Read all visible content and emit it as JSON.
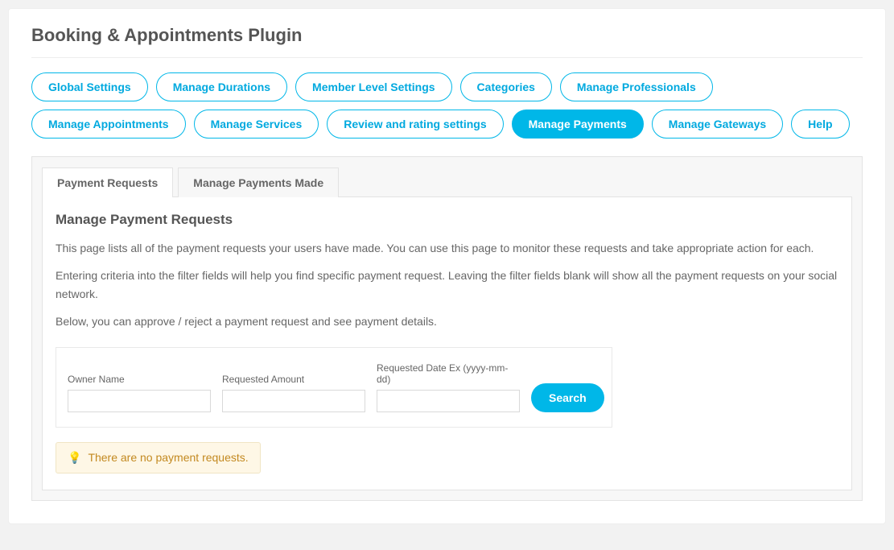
{
  "header": {
    "title": "Booking & Appointments Plugin"
  },
  "nav_pills": {
    "global_settings": "Global Settings",
    "manage_durations": "Manage Durations",
    "member_level_settings": "Member Level Settings",
    "categories": "Categories",
    "manage_professionals": "Manage Professionals",
    "manage_appointments": "Manage Appointments",
    "manage_services": "Manage Services",
    "review_rating_settings": "Review and rating settings",
    "manage_payments": "Manage Payments",
    "manage_gateways": "Manage Gateways",
    "help": "Help"
  },
  "tabs": {
    "payment_requests": "Payment Requests",
    "manage_payments_made": "Manage Payments Made"
  },
  "content": {
    "section_title": "Manage Payment Requests",
    "desc1": "This page lists all of the payment requests your users have made. You can use this page to monitor these requests and take appropriate action for each.",
    "desc2": "Entering criteria into the filter fields will help you find specific payment request. Leaving the filter fields blank will show all the payment requests on your social network.",
    "desc3": "Below, you can approve / reject a payment request and see payment details."
  },
  "filters": {
    "owner_name_label": "Owner Name",
    "owner_name_value": "",
    "requested_amount_label": "Requested Amount",
    "requested_amount_value": "",
    "requested_date_label": "Requested Date Ex (yyyy-mm-dd)",
    "requested_date_value": "",
    "search_button": "Search"
  },
  "notice": {
    "message": "There are no payment requests."
  }
}
